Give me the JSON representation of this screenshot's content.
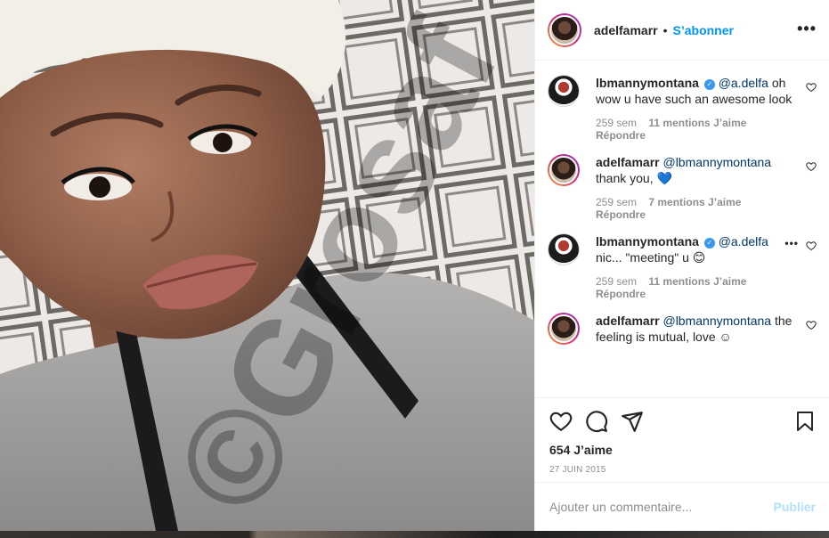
{
  "post": {
    "author": "adelfamarr",
    "separator": "•",
    "follow_label": "S’abonner",
    "more_label": "•••",
    "photo_watermark": "©Grosaf"
  },
  "comments": [
    {
      "user": "lbmannymontana",
      "verified": true,
      "mention": "@a.delfa",
      "text": " oh wow u have such an awesome look",
      "age": "259 sem",
      "likes": "11 mentions J’aime",
      "reply": "Répondre"
    },
    {
      "user": "adelfamarr",
      "verified": false,
      "mention": "@lbmannymontana",
      "text": " thank you, 💙",
      "age": "259 sem",
      "likes": "7 mentions J’aime",
      "reply": "Répondre"
    },
    {
      "user": "lbmannymontana",
      "verified": true,
      "mention": "@a.delfa",
      "text": " nic... \"meeting\" u 😊",
      "age": "259 sem",
      "likes": "11 mentions J’aime",
      "reply": "Répondre"
    },
    {
      "user": "adelfamarr",
      "verified": false,
      "mention": "@lbmannymontana",
      "text": " the feeling is mutual, love ☺"
    }
  ],
  "actions": {
    "likes_count": "654 J’aime",
    "date": "27 JUIN 2015",
    "icons": [
      "heart-icon",
      "comment-icon",
      "share-icon",
      "bookmark-icon"
    ]
  },
  "compose": {
    "placeholder": "Ajouter un commentaire...",
    "post_label": "Publier"
  },
  "colors": {
    "accent": "#0095f6",
    "verified": "#3897f0",
    "muted": "#8e8e8e"
  }
}
